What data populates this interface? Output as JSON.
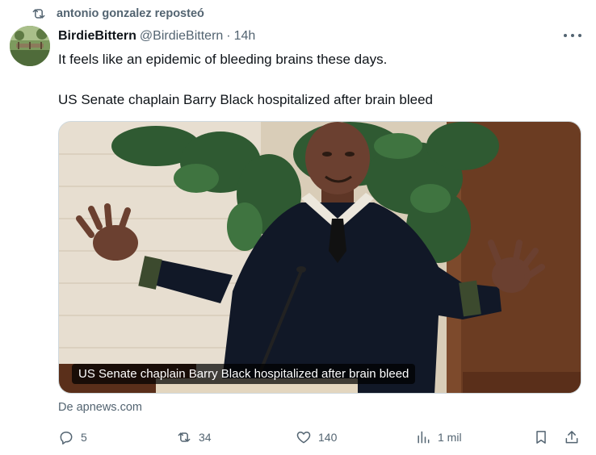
{
  "repost": {
    "text": "antonio gonzalez reposteó"
  },
  "author": {
    "display_name": "BirdieBittern",
    "handle": "@BirdieBittern",
    "separator": "·",
    "time": "14h"
  },
  "tweet": {
    "line1": "It feels like an epidemic of bleeding brains these days.",
    "line2": "US Senate chaplain Barry Black hospitalized after brain bleed"
  },
  "media": {
    "caption": "US Senate chaplain Barry Black hospitalized after brain bleed"
  },
  "link": {
    "source": "De apnews.com"
  },
  "actions": {
    "replies": "5",
    "reposts": "34",
    "likes": "140",
    "views": "1 mil"
  },
  "icons": {
    "repost": "repost-icon",
    "more": "more-icon",
    "reply": "reply-icon",
    "like": "heart-icon",
    "views": "analytics-icon",
    "bookmark": "bookmark-icon",
    "share": "share-icon"
  },
  "colors": {
    "text": "#0f1419",
    "secondary": "#536471",
    "border": "#cfd9de"
  }
}
